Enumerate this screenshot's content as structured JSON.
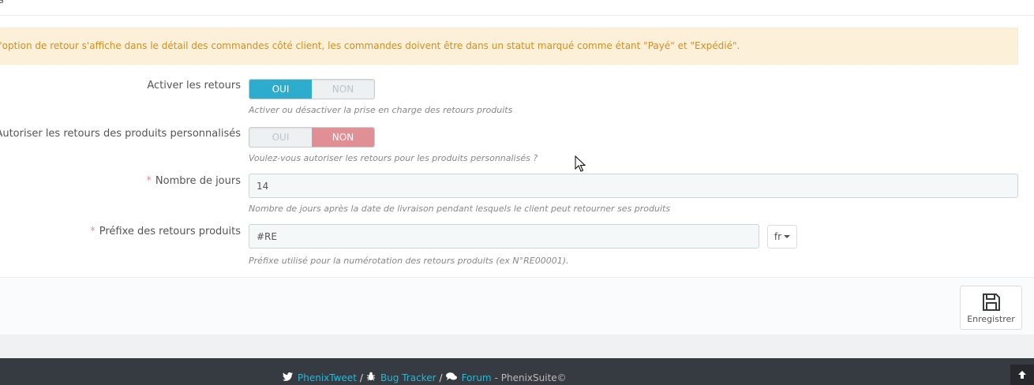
{
  "heading": {
    "fragment": "s"
  },
  "alert": {
    "text": "l'option de retour s'affiche dans le détail des commandes côté client, les commandes doivent être dans un statut marqué comme étant \"Payé\" et \"Expédié\"."
  },
  "form": {
    "enable_returns": {
      "label": "Activer les retours",
      "yes": "OUI",
      "no": "NON",
      "value": "OUI",
      "help": "Activer ou désactiver la prise en charge des retours produits"
    },
    "custom_returns": {
      "label": "Autoriser les retours des produits personnalisés",
      "yes": "OUI",
      "no": "NON",
      "value": "NON",
      "help": "Voulez-vous autoriser les retours pour les produits personnalisés ?"
    },
    "days": {
      "required_mark": "*",
      "label": "Nombre de jours",
      "value": "14",
      "help": "Nombre de jours après la date de livraison pendant lesquels le client peut retourner ses produits"
    },
    "prefix": {
      "required_mark": "*",
      "label": "Préfixe des retours produits",
      "value": "#RE",
      "lang": "fr",
      "help": "Préfixe utilisé pour la numérotation des retours produits (ex N°RE00001)."
    }
  },
  "footer": {
    "save_label": "Enregistrer"
  },
  "bottom": {
    "tweet": "PhenixTweet",
    "sep1": "/",
    "bugtracker": "Bug Tracker",
    "sep2": "/",
    "forum": "Forum",
    "suite": "- PhenixSuite©"
  },
  "colors": {
    "switch_on_yes": "#2eacce",
    "switch_on_no": "#e08f95",
    "alert_bg": "#fcf0d9",
    "alert_text": "#d38f23",
    "link": "#25b9d7"
  }
}
